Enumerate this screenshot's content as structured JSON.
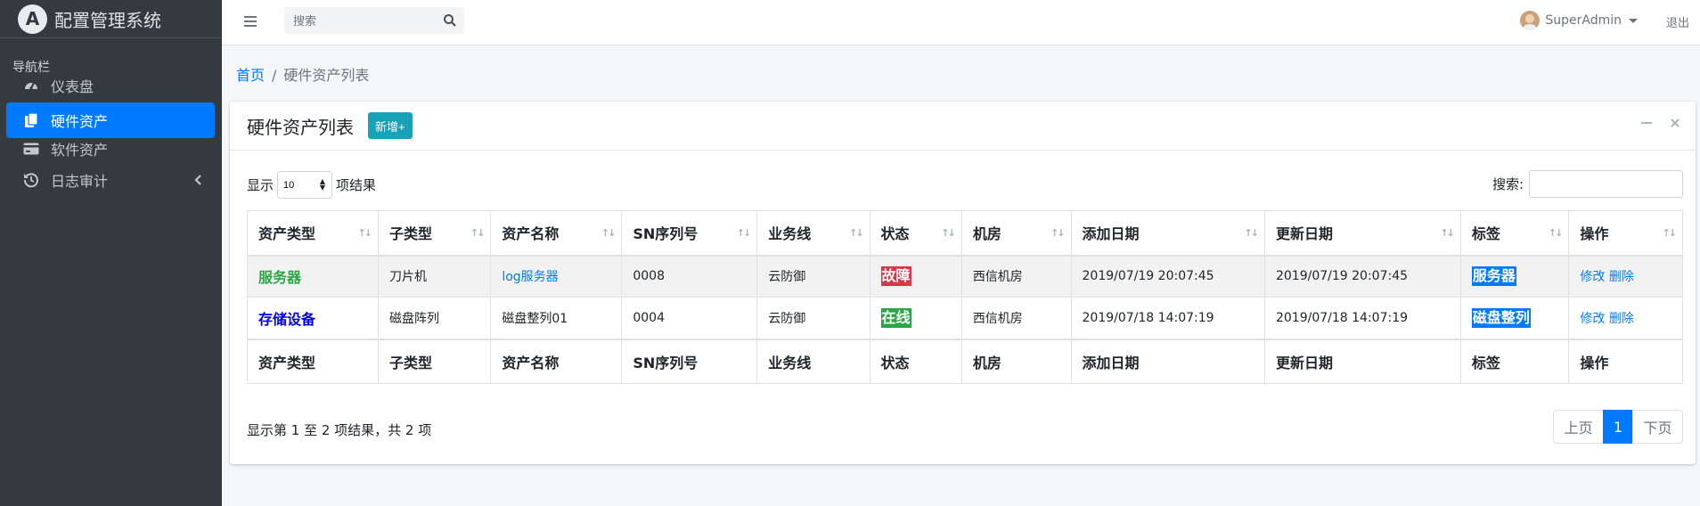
{
  "app": {
    "logo_letter": "A",
    "title": "配置管理系统"
  },
  "sidebar": {
    "header": "导航栏",
    "items": [
      {
        "label": "仪表盘",
        "icon": "tachometer-icon",
        "active": false
      },
      {
        "label": "硬件资产",
        "icon": "copy-icon",
        "active": true
      },
      {
        "label": "软件资产",
        "icon": "credit-card-icon",
        "active": false
      },
      {
        "label": "日志审计",
        "icon": "history-icon",
        "active": false
      }
    ]
  },
  "topbar": {
    "search_placeholder": "搜索",
    "user_name": "SuperAdmin",
    "logout_label": "退出"
  },
  "breadcrumb": {
    "home": "首页",
    "sep": "/",
    "current": "硬件资产列表"
  },
  "card": {
    "title": "硬件资产列表",
    "new_button": "新增+",
    "length_prefix": "显示",
    "length_value": "10",
    "length_suffix": "项结果",
    "search_label": "搜索:",
    "columns": [
      "资产类型",
      "子类型",
      "资产名称",
      "SN序列号",
      "业务线",
      "状态",
      "机房",
      "添加日期",
      "更新日期",
      "标签",
      "操作"
    ],
    "rows": [
      {
        "type": "服务器",
        "subtype": "刀片机",
        "name": "log服务器",
        "sn": "0008",
        "line": "云防御",
        "status": "故障",
        "room": "西信机房",
        "added": "2019/07/19 20:07:45",
        "updated": "2019/07/19 20:07:45",
        "tag": "服务器",
        "edit": "修改",
        "delete": "删除"
      },
      {
        "type": "存储设备",
        "subtype": "磁盘阵列",
        "name": "磁盘整列01",
        "sn": "0004",
        "line": "云防御",
        "status": "在线",
        "room": "西信机房",
        "added": "2019/07/18 14:07:19",
        "updated": "2019/07/18 14:07:19",
        "tag": "磁盘整列",
        "edit": "修改",
        "delete": "删除"
      }
    ],
    "info": "显示第 1 至 2 项结果，共 2 项",
    "pager": {
      "prev": "上页",
      "current": "1",
      "next": "下页"
    }
  },
  "colors": {
    "sidebar": "#343a40",
    "active": "#007bff",
    "new_button": "#17a2b8",
    "fault": "#dc3545",
    "online": "#28a745"
  }
}
